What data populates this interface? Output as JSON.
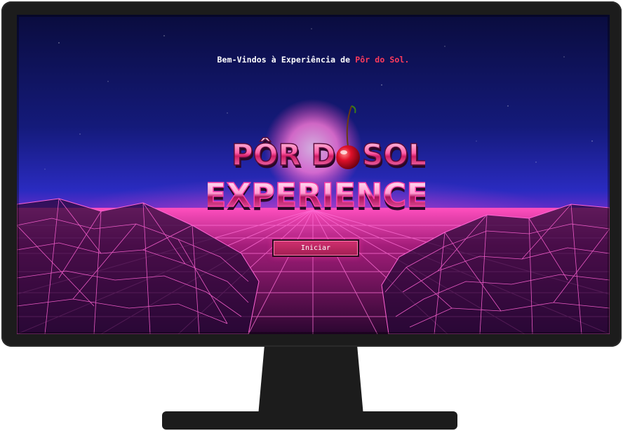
{
  "welcome": {
    "prefix": "Bem-Vindos à Experiência de",
    "highlight": "Pôr do Sol."
  },
  "logo": {
    "line1_part1": "PÔR D",
    "line1_part2": "SOL",
    "line2": "EXPERIENCE"
  },
  "start_button": {
    "label": "Iniciar"
  },
  "colors": {
    "sky_top": "#070a3a",
    "sky_mid": "#1a1f8c",
    "horizon_glow": "#ff3fb4",
    "grid_line": "#ff4fc8",
    "accent": "#ff3b5c",
    "button": "#c02a63",
    "monitor_bezel": "#1c1c1c"
  },
  "icons": {
    "cherry": "cherry-icon"
  }
}
